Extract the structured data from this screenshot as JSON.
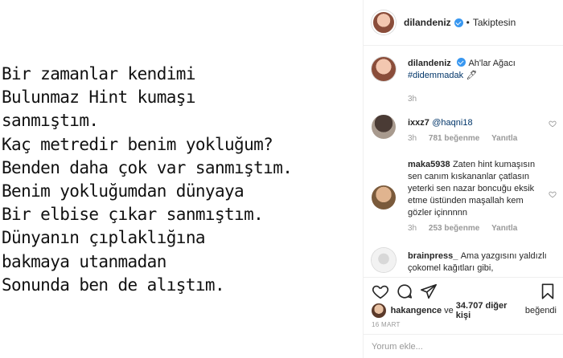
{
  "poem": {
    "lines": [
      "Bir zamanlar kendimi",
      "Bulunmaz Hint kumaşı",
      "sanmıştım.",
      "Kaç metredir benim yokluğum?",
      "Benden daha çok var sanmıştım.",
      "Benim yokluğumdan dünyaya",
      "Bir elbise çıkar sanmıştım.",
      "Dünyanın çıplaklığına",
      "bakmaya utanmadan",
      "Sonunda ben de alıştım."
    ]
  },
  "header": {
    "username": "dilandeniz",
    "separator": "•",
    "follow_label": "Takiptesin"
  },
  "caption": {
    "username": "dilandeniz",
    "text": "Ah'lar Ağacı",
    "hashtag": "#didemmadak",
    "emoji": "🖊",
    "time": "3h"
  },
  "comments": [
    {
      "username": "ixxz7",
      "text": "@haqni18",
      "time": "3h",
      "likes": "781 beğenme",
      "reply": "Yanıtla"
    },
    {
      "username": "maka5938",
      "text": "Zaten hint kumaşısın sen canım kıskananlar çatlasın yeterki sen nazar boncuğu eksik etme üstünden maşallah kem gözler içinnnnn",
      "time": "3h",
      "likes": "253 beğenme",
      "reply": "Yanıtla"
    },
    {
      "username": "brainpress_",
      "text": "Ama yazgısını yaldızlı çokomel kağıtları gibi,"
    }
  ],
  "likes": {
    "user": "hakangence",
    "connector": "ve",
    "count_text": "34.707 diğer kişi",
    "suffix": "beğendi"
  },
  "date": "16 MART",
  "comment_input": {
    "placeholder": "Yorum ekle..."
  },
  "icons": {
    "like": "heart-icon",
    "comment": "comment-icon",
    "share": "share-icon",
    "save": "bookmark-icon"
  }
}
